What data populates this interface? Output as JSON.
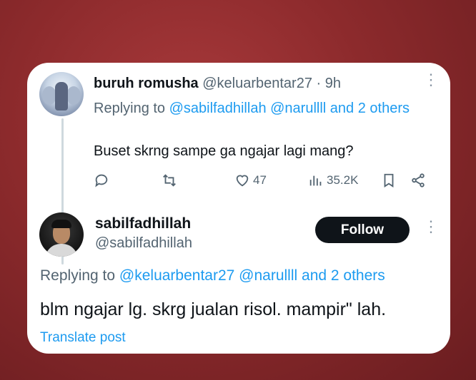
{
  "parent_tweet": {
    "display_name": "buruh romusha",
    "handle": "@keluarbentar27",
    "separator": "·",
    "time": "9h",
    "replying_prefix": "Replying to",
    "mention_1": "@sabilfadhillah",
    "mention_2": "@narullll",
    "others": "and 2 others",
    "text": "Buset skrng sampe ga ngajar lagi mang?",
    "likes": "47",
    "views": "35.2K"
  },
  "main_tweet": {
    "display_name": "sabilfadhillah",
    "handle": "@sabilfadhillah",
    "follow_label": "Follow",
    "replying_prefix": "Replying to",
    "mention_1": "@keluarbentar27",
    "mention_2": "@narullll",
    "others": "and 2 others",
    "text": "blm ngajar lg. skrg jualan risol. mampir\" lah.",
    "translate_label": "Translate post"
  },
  "colors": {
    "background": "#8c2a2c",
    "card": "#ffffff",
    "link": "#1d9bf0",
    "secondary_text": "#536471",
    "primary_text": "#0f1419",
    "follow_button": "#0f1419"
  },
  "icons": [
    "reply-icon",
    "retweet-icon",
    "like-icon",
    "views-icon",
    "bookmark-icon",
    "share-icon",
    "more-options-icon"
  ]
}
